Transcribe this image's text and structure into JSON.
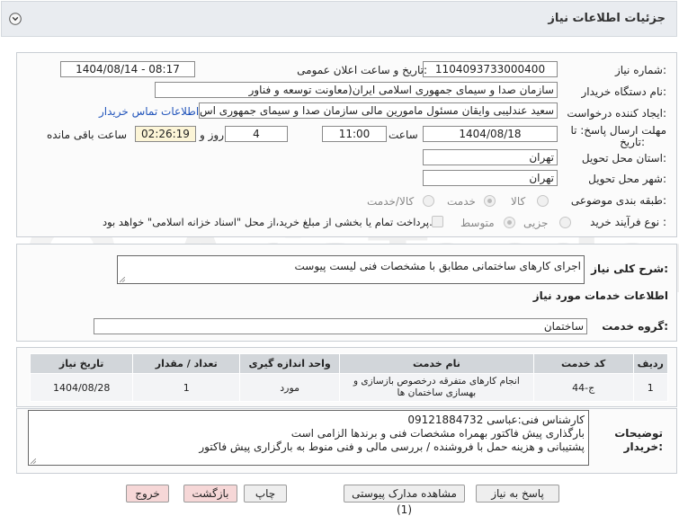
{
  "header": {
    "title": "جزئیات اطلاعات نیاز"
  },
  "watermark": "AriaTender.net",
  "info": {
    "need_number_label": "شماره نیاز:",
    "need_number": "1104093733000400",
    "announce_label": "تاریخ و ساعت اعلان عمومی:",
    "announce_value": "1404/08/14 - 08:17",
    "buyer_org_label": "نام دستگاه خریدار:",
    "buyer_org": "سازمان صدا و سیمای جمهوری اسلامی ایران(معاونت توسعه و فناور",
    "creator_label": "ایجاد کننده درخواست:",
    "creator": "سعید عندلیبی وایقان مسئول مامورین مالی  سازمان صدا و سیمای جمهوری اس",
    "contact_link": "اطلاعات تماس خریدار",
    "deadline_label_1": "مهلت ارسال پاسخ: تا",
    "deadline_label_2": "تاریخ:",
    "deadline_date": "1404/08/18",
    "time_label": "ساعت",
    "deadline_time": "11:00",
    "days_value": "4",
    "days_label": "روز و",
    "remaining_time": "02:26:19",
    "remaining_label": "ساعت باقی مانده",
    "province_label": "استان محل تحویل:",
    "province": "تهران",
    "city_label": "شهر محل تحویل:",
    "city": "تهران",
    "category_label": "طبقه بندی موضوعی:",
    "category_options": [
      "کالا",
      "خدمت",
      "کالا/خدمت"
    ],
    "process_label": "نوع فرآیند خرید :",
    "process_options": [
      "جزیی",
      "متوسط"
    ],
    "payment_note": "پرداخت تمام یا بخشی از مبلغ خرید،از محل \"اسناد خزانه اسلامی\" خواهد بود."
  },
  "general": {
    "desc_label": "شرح کلی نیاز:",
    "desc_value": "اجرای کارهای ساختمانی مطابق با مشخصات فنی لیست پیوست",
    "services_heading": "اطلاعات خدمات مورد نیاز",
    "group_label": "گروه خدمت:",
    "group_value": "ساختمان"
  },
  "table": {
    "headers": [
      "ردیف",
      "کد خدمت",
      "نام خدمت",
      "واحد اندازه گیری",
      "تعداد / مقدار",
      "تاریخ نیاز"
    ],
    "rows": [
      [
        "1",
        "ج-44",
        "انجام کارهای متفرقه درخصوص بازسازی و بهسازی ساختمان ها",
        "مورد",
        "1",
        "1404/08/28"
      ]
    ]
  },
  "notes": {
    "label_1": "توضیحات",
    "label_2": "خریدار:",
    "lines": [
      "کارشناس فنی:عباسی 09121884732",
      "بارگذاری پیش فاکتور بهمراه مشخصات فنی و برندها الزامی است",
      "پشتیبانی و هزینه حمل با فروشنده / بررسی مالی و فنی منوط به بارگزاری پیش فاکتور"
    ]
  },
  "buttons": {
    "reply": "پاسخ به نیاز",
    "attachments": "مشاهده مدارک پیوستی (1)",
    "print": "چاپ",
    "back": "بازگشت",
    "exit": "خروج"
  }
}
